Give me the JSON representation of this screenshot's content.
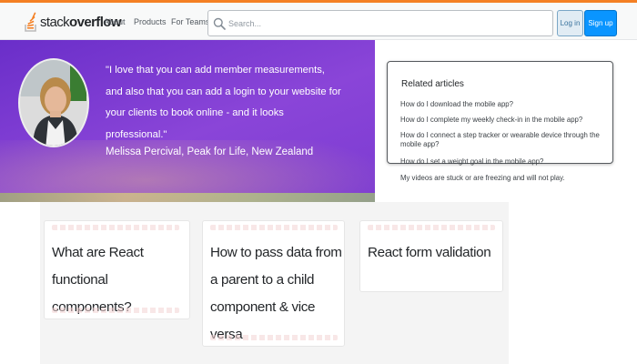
{
  "header": {
    "logo_text_regular": "stack",
    "logo_text_bold": "overflow",
    "nav": [
      "About",
      "Products",
      "For Teams"
    ],
    "search": {
      "placeholder": "Search..."
    },
    "login_label": "Log in",
    "signup_label": "Sign up",
    "brand_color": "#f48024"
  },
  "hero": {
    "quote": "\"I love that you can add member measurements, and also that you can add a login to your website for your clients to book online - and it looks professional.\"",
    "author": "Melissa Percival, Peak for Life, New Zealand",
    "background_color": "#7a3bd4"
  },
  "related": {
    "title": "Related articles",
    "items": [
      "How do I download the mobile app?",
      "How do I complete my weekly check-in in the mobile app?",
      "How do I connect a step tracker or wearable device through the mobile app?",
      "How do I set a weight goal in the mobile app?",
      "My videos are stuck or are freezing and will not play."
    ]
  },
  "cards": [
    {
      "title": "What are React functional components?"
    },
    {
      "title": "How to pass data from a parent to a child component & vice versa"
    },
    {
      "title": "React form validation"
    }
  ]
}
